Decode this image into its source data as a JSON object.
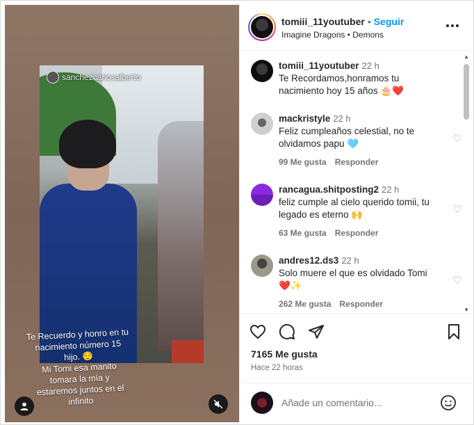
{
  "media": {
    "overlay_handle": "sanchezcarlosalberto",
    "caption": "Te Recuerdo y honro en tu\nnacimiento número 15\nhijo. 😌\nMi Tomi esa manito\ntomara la mía y\nestaremos juntos en el\ninfinito"
  },
  "header": {
    "username": "tomiii_11youtuber",
    "separator": "•",
    "follow_label": "Seguir",
    "song": "Imagine Dragons • Demons",
    "more_icon": "more-options-icon"
  },
  "comments": [
    {
      "username": "tomiii_11youtuber",
      "time": "22 h",
      "text": "Te Recordamos,honramos tu nacimiento hoy 15 años 🎂❤️",
      "likes": "",
      "reply": ""
    },
    {
      "username": "mackristyle",
      "time": "22 h",
      "text": "Feliz cumpleaños celestial, no te olvidamos papu 🩵",
      "likes": "99 Me gusta",
      "reply": "Responder"
    },
    {
      "username": "rancagua.shitposting2",
      "time": "22 h",
      "text": "feliz cumple al cielo querido tomii, tu legado es eterno 🙌",
      "likes": "63 Me gusta",
      "reply": "Responder"
    },
    {
      "username": "andres12.ds3",
      "time": "22 h",
      "text": "Solo muere el que es olvidado Tomi ❤️✨",
      "likes": "262 Me gusta",
      "reply": "Responder"
    }
  ],
  "actions": {
    "likes": "7165 Me gusta",
    "posted_ago": "Hace 22 horas"
  },
  "add_comment": {
    "placeholder": "Añade un comentario..."
  },
  "colors": {
    "accent": "#0095f6",
    "text": "#262626",
    "muted": "#737373"
  }
}
